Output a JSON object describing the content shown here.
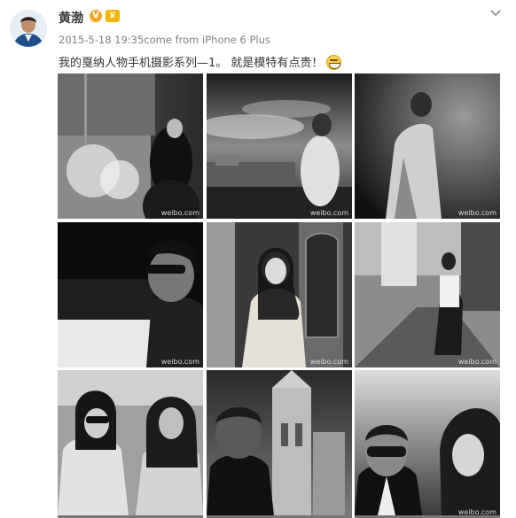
{
  "post": {
    "author": "黄渤",
    "badge_verified": "V",
    "badge_vip": "♛",
    "timestamp": "2015-5-18 19:35",
    "source_prefix": "come from ",
    "source": "iPhone 6 Plus",
    "text": "我的戛纳人物手机摄影系列—1。 就是模特有点贵！",
    "emoji": "grin-emoji"
  },
  "colors": {
    "name": "#333333",
    "meta": "#808080",
    "badge": "#f5a623"
  },
  "photos": [
    {
      "alt": "woman in glass gallery",
      "watermark": "weibo.com"
    },
    {
      "alt": "woman on balcony over rooftops",
      "watermark": "weibo.com"
    },
    {
      "alt": "man in coat under dark sky",
      "watermark": "weibo.com"
    },
    {
      "alt": "man in sunglasses close-up",
      "watermark": "weibo.com"
    },
    {
      "alt": "woman in trench coat by ornate door",
      "watermark": "weibo.com"
    },
    {
      "alt": "woman on walkway",
      "watermark": "weibo.com"
    },
    {
      "alt": "two women in sunglasses",
      "watermark": ""
    },
    {
      "alt": "man below cathedral tower",
      "watermark": ""
    },
    {
      "alt": "selfie of two people",
      "watermark": "weibo.com"
    }
  ]
}
